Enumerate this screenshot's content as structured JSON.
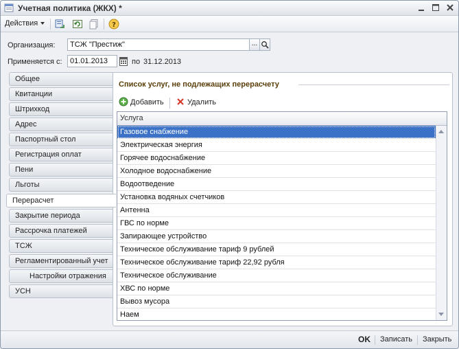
{
  "window": {
    "title": "Учетная политика (ЖКХ) *"
  },
  "toolbar": {
    "actions_label": "Действия"
  },
  "form": {
    "organization_label": "Организация:",
    "organization_value": "ТСЖ \"Престиж\"",
    "organization_select_button": "...",
    "applies_label": "Применяется с:",
    "applies_from": "01.01.2013",
    "to_label": "по",
    "applies_to": "31.12.2013"
  },
  "tabs": [
    {
      "label": "Общее"
    },
    {
      "label": "Квитанции"
    },
    {
      "label": "Штрихкод"
    },
    {
      "label": "Адрес"
    },
    {
      "label": "Паспортный стол"
    },
    {
      "label": "Регистрация оплат"
    },
    {
      "label": "Пени"
    },
    {
      "label": "Льготы"
    },
    {
      "label": "Перерасчет"
    },
    {
      "label": "Закрытие периода"
    },
    {
      "label": "Рассрочка платежей"
    },
    {
      "label": "ТСЖ"
    },
    {
      "label": "Регламентированный учет"
    },
    {
      "label": "Настройки отражения"
    },
    {
      "label": "УСН"
    }
  ],
  "panel": {
    "group_title": "Список услуг, не подлежащих перерасчету",
    "add_label": "Добавить",
    "delete_label": "Удалить",
    "column_header": "Услуга",
    "rows": [
      "Газовое снабжение",
      "Электрическая энергия",
      "Горячее водоснабжение",
      "Холодное водоснабжение",
      "Водоотведение",
      "Установка водяных счетчиков",
      "Антенна",
      "ГВС по норме",
      "Запирающее устройство",
      "Техническое обслуживание тариф 9 рублей",
      "Техническое обслуживание тариф 22,92 рубля",
      "Техническое обслуживание",
      "ХВС по норме",
      "Вывоз мусора",
      "Наем"
    ]
  },
  "bottom": {
    "ok_label": "OK",
    "save_label": "Записать",
    "close_label": "Закрыть"
  },
  "colors": {
    "selection": "#3b71c6",
    "group_title": "#5a3e0a"
  }
}
